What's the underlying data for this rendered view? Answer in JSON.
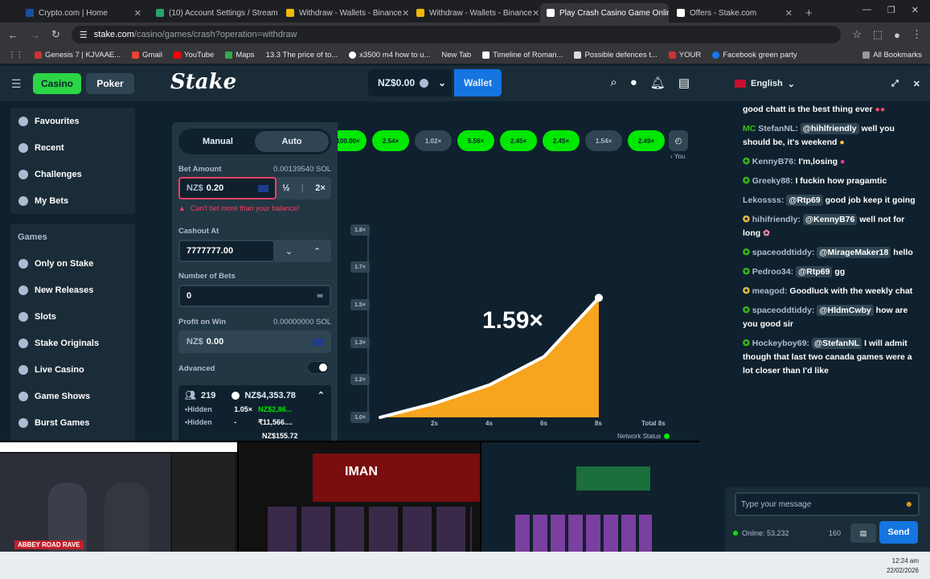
{
  "browser": {
    "tabs": [
      {
        "title": "Crypto.com | Home",
        "color": "#1a4fa0"
      },
      {
        "title": "(10) Account Settings / Streami",
        "color": "#2ba36c"
      },
      {
        "title": "Withdraw - Wallets - Binance",
        "color": "#f0b90b"
      },
      {
        "title": "Withdraw - Wallets - Binance",
        "color": "#f0b90b"
      },
      {
        "title": "Play Crash Casino Game Online",
        "color": "#ffffff"
      },
      {
        "title": "Offers - Stake.com",
        "color": "#ffffff"
      }
    ],
    "active_tab": 4,
    "url_host": "stake.com",
    "url_path": "/casino/games/crash?operation=withdraw",
    "bookmarks": [
      "Genesis 7 | KJVAAE...",
      "Gmail",
      "YouTube",
      "Maps",
      "13.3 The price of to...",
      "x3500 m4 how to u...",
      "New Tab",
      "Timeline of Roman...",
      "Possible defences t...",
      "YOUR",
      "Facebook green party"
    ],
    "all_bookmarks": "All Bookmarks"
  },
  "header": {
    "casino": "Casino",
    "poker": "Poker",
    "logo": "Stake",
    "balance": "NZ$0.00",
    "wallet": "Wallet"
  },
  "sidebar": {
    "group1": [
      "Favourites",
      "Recent",
      "Challenges",
      "My Bets"
    ],
    "games_heading": "Games",
    "group2": [
      "Only on Stake",
      "New Releases",
      "Slots",
      "Stake Originals",
      "Live Casino",
      "Game Shows",
      "Burst Games"
    ]
  },
  "bet_panel": {
    "tab_manual": "Manual",
    "tab_auto": "Auto",
    "bet_amount_label": "Bet Amount",
    "bet_amount_sol": "0.00139540 SOL",
    "bet_currency": "NZ$",
    "bet_value": "0.20",
    "half": "½",
    "double": "2×",
    "error": "Can't bet more than your balance!",
    "cashout_label": "Cashout At",
    "cashout_value": "7777777.00",
    "num_bets_label": "Number of Bets",
    "num_bets_value": "0",
    "profit_label": "Profit on Win",
    "profit_sol": "0.00000000 SOL",
    "profit_currency": "NZ$",
    "profit_value": "0.00",
    "advanced": "Advanced",
    "players": "219",
    "pot": "NZ$4,353.78",
    "bets": [
      {
        "user": "Hidden",
        "mult": "1.05×",
        "amount": "NZ$2,86..."
      },
      {
        "user": "Hidden",
        "mult": "-",
        "amount": "₹11,566...."
      },
      {
        "user": "",
        "mult": "",
        "amount": "NZ$155.72"
      }
    ]
  },
  "game": {
    "history": [
      "109.00×",
      "2.54×",
      "1.02×",
      "5.56×",
      "2.45×",
      "2.45×",
      "1.54×",
      "2.49×"
    ],
    "history_green": [
      true,
      true,
      false,
      true,
      true,
      true,
      false,
      true
    ],
    "you_label": "‹ You",
    "multiplier": "1.59×",
    "y_ticks": [
      "1.8×",
      "1.7×",
      "1.5×",
      "1.3×",
      "1.2×",
      "1.0×"
    ],
    "x_ticks": [
      "2s",
      "4s",
      "6s",
      "8s"
    ],
    "total": "Total 8s",
    "network_status": "Network Status"
  },
  "chat": {
    "language": "English",
    "messages": [
      {
        "user": "",
        "text": "good chatt is the best thing ever"
      },
      {
        "user": "StefanNL:",
        "mention": "@hihlfriendly",
        "text": "well you should be, it's weekend"
      },
      {
        "user": "KennyB76:",
        "mention": "",
        "text": "I'm,losing"
      },
      {
        "user": "Greeky88:",
        "mention": "",
        "text": "I fuckin how pragamtic"
      },
      {
        "user": "Lekossss:",
        "mention": "@Rtp69",
        "text": "good job keep it going"
      },
      {
        "user": "hihifriendly:",
        "mention": "@KennyB76",
        "text": "well not for long"
      },
      {
        "user": "spaceoddtiddy:",
        "mention": "@MirageMaker18",
        "text": "hello"
      },
      {
        "user": "Pedroo34:",
        "mention": "@Rtp69",
        "text": "gg"
      },
      {
        "user": "meagod:",
        "mention": "",
        "text": "Goodluck with the weekly chat"
      },
      {
        "user": "spaceoddtiddy:",
        "mention": "@HldmCwby",
        "text": "how are you good sir"
      },
      {
        "user": "Hockeyboy69:",
        "mention": "@StefanNL",
        "text": "I will admit though that last two canada games were a lot closer than I'd like"
      }
    ],
    "placeholder": "Type your message",
    "online": "Online: 53,232",
    "count": "160",
    "send": "Send"
  },
  "taskbar": {
    "time": "12:24 am",
    "date": "22/02/2026"
  },
  "overlay": {
    "thumb_title": "ABBEY ROAD RAVE",
    "thumb2_title": "IMAN"
  },
  "chart_data": {
    "type": "line",
    "x": [
      0,
      2,
      4,
      6,
      8
    ],
    "y": [
      1.0,
      1.07,
      1.16,
      1.3,
      1.59
    ],
    "xlabel": "",
    "ylabel": "",
    "y_ticks": [
      "1.0×",
      "1.2×",
      "1.3×",
      "1.5×",
      "1.7×",
      "1.8×"
    ],
    "x_ticks": [
      "2s",
      "4s",
      "6s",
      "8s"
    ],
    "fill": "#f7a41e",
    "line": "#ffffff"
  }
}
